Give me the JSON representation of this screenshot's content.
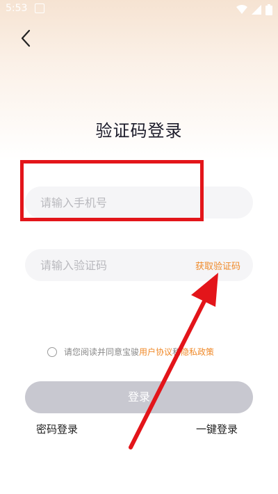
{
  "status_bar": {
    "time": "5:53"
  },
  "header": {
    "title": "验证码登录"
  },
  "form": {
    "phone_placeholder": "请输入手机号",
    "code_placeholder": "请输入验证码",
    "get_code_label": "获取验证码"
  },
  "agreement": {
    "prefix": "请您阅读并同意宝骏",
    "user_agreement": "用户协议",
    "connector": "和",
    "privacy_policy": "隐私政策"
  },
  "actions": {
    "login_label": "登录",
    "password_login_label": "密码登录",
    "one_tap_login_label": "一键登录"
  },
  "colors": {
    "accent": "#f08a2a",
    "highlight": "#e3151a",
    "login_button_disabled": "#c8c8d0"
  }
}
